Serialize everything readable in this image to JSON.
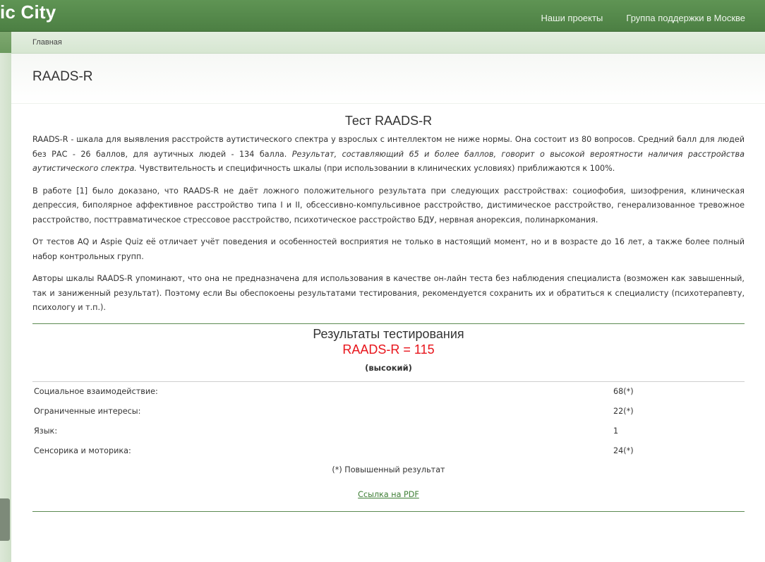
{
  "header": {
    "brand": "ic City",
    "nav": [
      "Наши проекты",
      "Группа поддержки в Москве"
    ]
  },
  "breadcrumb": "Главная",
  "page_title": "RAADS-R",
  "test": {
    "heading": "Тест RAADS-R",
    "p1_a": "RAADS-R - шкала для выявления расстройств аутистического спектра у взрослых с интеллектом не ниже нормы. Она состоит из 80 вопросов. Средний балл для людей без РАС - 26 баллов, для аутичных людей - 134 балла. ",
    "p1_em": "Результат, составляющий 65 и более баллов, говорит о высокой вероятности наличия расстройства аутистического спектра.",
    "p1_b": " Чувствительность и специфичность шкалы (при использовании в клинических условиях) приближаются к 100%.",
    "p2": "В работе [1] было доказано, что RAADS-R не даёт ложного положительного результата при следующих расстройствах: социофобия, шизофрения, клиническая депрессия, биполярное аффективное расстройство типа I и II, обсессивно-компульсивное расстройство, дистимическое расстройство, генерализованное тревожное расстройство, посттравматическое стрессовое расстройство, психотическое расстройство БДУ, нервная анорексия, полинаркомания.",
    "p3": "От тестов AQ и Aspie Quiz её отличает учёт поведения и особенностей восприятия не только в настоящий момент, но и в возрасте до 16 лет, а также более полный набор контрольных групп.",
    "p4": "Авторы шкалы RAADS-R упоминают, что она не предназначена для использования в качестве он-лайн теста без наблюдения специалиста (возможен как завышенный, так и заниженный результат). Поэтому если Вы обеспокоены результатами тестирования, рекомендуется сохранить их и обратиться к специалисту (психотерапевту, психологу и т.п.)."
  },
  "results": {
    "title": "Результаты тестирования",
    "score": "RAADS-R = 115",
    "level": "(высокий)",
    "rows": [
      {
        "label": "Социальное взаимодействие:",
        "value": "68(*)"
      },
      {
        "label": "Ограниченные интересы:",
        "value": "22(*)"
      },
      {
        "label": "Язык:",
        "value": "1"
      },
      {
        "label": "Сенсорика и моторика:",
        "value": "24(*)"
      }
    ],
    "footnote": "(*) Повышенный результат",
    "pdf_link": "Ссылка на PDF"
  },
  "colors": {
    "header_green": "#4c7f43",
    "score_red": "#e8141b",
    "link_green": "#3f7f36",
    "divider_green": "#5b8a52"
  }
}
